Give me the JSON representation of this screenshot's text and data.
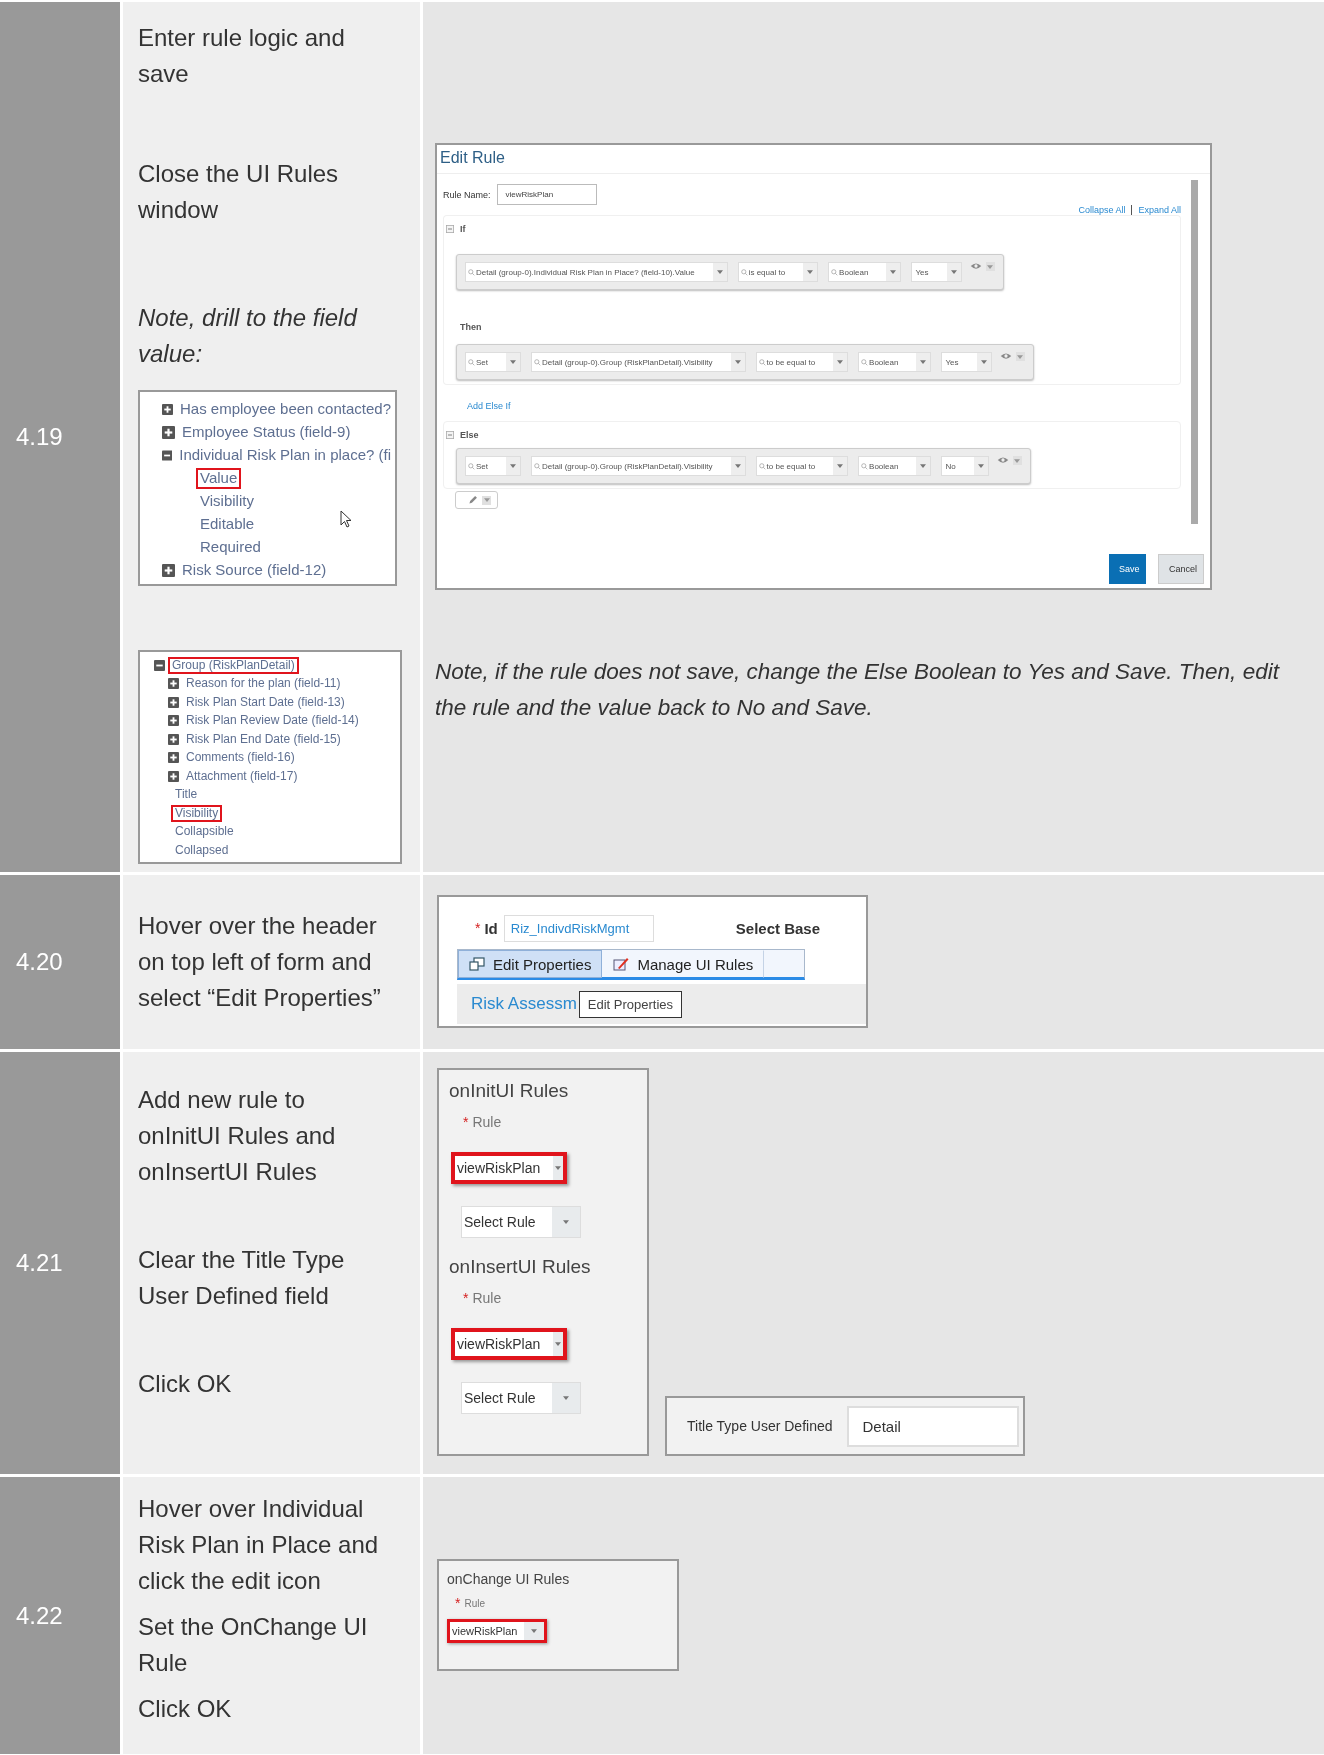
{
  "rows": [
    {
      "number": "4.19",
      "instructions": [
        {
          "text": "Enter rule logic and save",
          "italic": false
        },
        {
          "text": "Close the UI Rules window",
          "italic": false
        },
        {
          "text": "Note, drill to the field value:",
          "italic": true
        }
      ],
      "trees": [
        {
          "items": [
            {
              "label": "Has employee been contacted?",
              "expanded": false,
              "highlighted": false
            },
            {
              "label": "Employee Status (field-9)",
              "expanded": false,
              "highlighted": false
            },
            {
              "label": "Individual Risk Plan in place? (fi",
              "expanded": true,
              "highlighted": false,
              "children": [
                {
                  "label": "Value",
                  "highlighted": true
                },
                {
                  "label": "Visibility",
                  "highlighted": false
                },
                {
                  "label": "Editable",
                  "highlighted": false
                },
                {
                  "label": "Required",
                  "highlighted": false
                }
              ]
            },
            {
              "label": "Risk Source (field-12)",
              "expanded": false,
              "highlighted": false
            }
          ]
        },
        {
          "items": [
            {
              "label": "Group (RiskPlanDetail)",
              "expanded": true,
              "highlighted": true,
              "children": [
                {
                  "label": "Reason for the plan (field-11)",
                  "expanded": false,
                  "highlighted": false
                },
                {
                  "label": "Risk Plan Start Date (field-13)",
                  "expanded": false,
                  "highlighted": false
                },
                {
                  "label": "Risk Plan Review Date (field-14)",
                  "expanded": false,
                  "highlighted": false
                },
                {
                  "label": "Risk Plan End Date (field-15)",
                  "expanded": false,
                  "highlighted": false
                },
                {
                  "label": "Comments (field-16)",
                  "expanded": false,
                  "highlighted": false
                },
                {
                  "label": "Attachment (field-17)",
                  "expanded": false,
                  "highlighted": false
                },
                {
                  "label": "Title",
                  "highlighted": false
                },
                {
                  "label": "Visibility",
                  "highlighted": true
                },
                {
                  "label": "Collapsible",
                  "highlighted": false
                },
                {
                  "label": "Collapsed",
                  "highlighted": false
                }
              ]
            }
          ]
        }
      ],
      "edit_rule": {
        "title": "Edit Rule",
        "rule_name_label": "Rule Name:",
        "rule_name": "viewRiskPlan",
        "links": [
          "Collapse All",
          "Expand All"
        ],
        "sections": [
          {
            "kind": "if",
            "label": "If",
            "expanded": true,
            "dropdowns": [
              {
                "text": "Detail (group-0).Individual Risk Plan in Place? (field-10).Value",
                "search": true
              },
              {
                "text": "is equal to",
                "search": true
              },
              {
                "text": "Boolean",
                "search": true
              },
              {
                "text": "Yes",
                "search": false
              }
            ]
          },
          {
            "kind": "then",
            "label": "Then",
            "dropdowns": [
              {
                "text": "Set",
                "search": true
              },
              {
                "text": "Detail (group-0).Group (RiskPlanDetail).Visibility",
                "search": true
              },
              {
                "text": "to be equal to",
                "search": true
              },
              {
                "text": "Boolean",
                "search": true
              },
              {
                "text": "Yes",
                "search": false
              }
            ]
          },
          {
            "kind": "else",
            "label": "Else",
            "expanded": true,
            "dropdowns": [
              {
                "text": "Set",
                "search": true
              },
              {
                "text": "Detail (group-0).Group (RiskPlanDetail).Visibility",
                "search": true
              },
              {
                "text": "to be equal to",
                "search": true
              },
              {
                "text": "Boolean",
                "search": true
              },
              {
                "text": "No",
                "search": false
              }
            ]
          }
        ],
        "add_else_if": "Add Else If",
        "save": "Save",
        "cancel": "Cancel"
      },
      "note": "Note, if the rule does not save, change the Else Boolean to Yes and Save. Then, edit the rule and the value back to No and Save."
    },
    {
      "number": "4.20",
      "instructions": [
        {
          "text": "Hover over the header on top left of form and select “Edit Properties”",
          "italic": false
        }
      ],
      "form_header": {
        "required_mark": "*",
        "id_label": "Id",
        "id_value": "Riz_IndivdRiskMgmt",
        "base_label": "Select Base",
        "menu": [
          {
            "label": "Edit Properties",
            "selected": true
          },
          {
            "label": "Manage UI Rules",
            "selected": false
          }
        ],
        "link": "Risk Assessm",
        "tooltip": "Edit Properties"
      }
    },
    {
      "number": "4.21",
      "instructions": [
        {
          "text": "Add new rule to onInitUI Rules and onInsertUI Rules",
          "italic": false
        },
        {
          "text": "Clear the Title Type User Defined field",
          "italic": false
        },
        {
          "text": "Click OK",
          "italic": false
        }
      ],
      "rule_sections": [
        {
          "title": "onInitUI Rules",
          "required_mark": "*",
          "rule_label": "Rule",
          "selects": [
            {
              "value": "viewRiskPlan",
              "highlighted": true
            },
            {
              "value": "Select Rule",
              "highlighted": false
            }
          ]
        },
        {
          "title": "onInsertUI Rules",
          "required_mark": "*",
          "rule_label": "Rule",
          "selects": [
            {
              "value": "viewRiskPlan",
              "highlighted": true
            },
            {
              "value": "Select Rule",
              "highlighted": false
            }
          ]
        }
      ],
      "title_type": {
        "label": "Title Type User Defined",
        "value": "Detail"
      }
    },
    {
      "number": "4.22",
      "instructions": [
        {
          "text": "Hover over Individual Risk Plan in Place and click the edit icon",
          "italic": false
        },
        {
          "text": "Set the OnChange UI Rule",
          "italic": false
        },
        {
          "text": "Click OK",
          "italic": false
        }
      ],
      "change_rules": {
        "title": "onChange UI Rules",
        "required_mark": "*",
        "rule_label": "Rule",
        "select": {
          "value": "viewRiskPlan",
          "highlighted": true
        }
      }
    }
  ]
}
